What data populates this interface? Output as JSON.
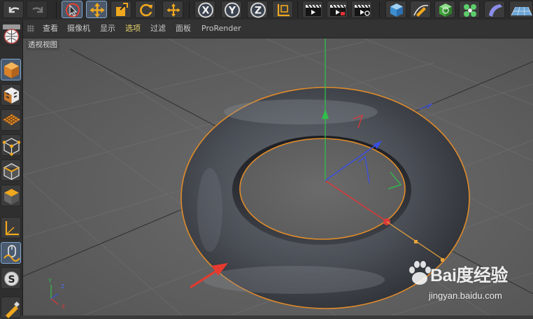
{
  "toolbar": {
    "buttons": [
      {
        "name": "undo-icon"
      },
      {
        "name": "redo-icon"
      },
      {
        "name": "live-selection-icon",
        "active": true
      },
      {
        "name": "move-icon"
      },
      {
        "name": "scale-icon"
      },
      {
        "name": "rotate-icon"
      },
      {
        "name": "recent-tool-icon"
      },
      {
        "name": "x-axis-lock-icon",
        "label": "X"
      },
      {
        "name": "y-axis-lock-icon",
        "label": "Y"
      },
      {
        "name": "z-axis-lock-icon",
        "label": "Z"
      },
      {
        "name": "coordinate-system-icon"
      },
      {
        "name": "render-view-icon"
      },
      {
        "name": "render-to-picture-viewer-icon"
      },
      {
        "name": "render-settings-icon"
      },
      {
        "name": "cube-primitive-icon"
      },
      {
        "name": "pen-spline-icon"
      },
      {
        "name": "subdivision-surface-icon"
      },
      {
        "name": "cloner-icon"
      },
      {
        "name": "bend-deformer-icon"
      },
      {
        "name": "floor-icon"
      }
    ]
  },
  "sidebar": {
    "buttons": [
      {
        "name": "make-editable-icon"
      },
      {
        "name": "model-mode-icon",
        "active": true
      },
      {
        "name": "texture-mode-icon"
      },
      {
        "name": "workplane-mode-icon"
      },
      {
        "name": "points-mode-icon"
      },
      {
        "name": "edges-mode-icon"
      },
      {
        "name": "polygons-mode-icon"
      },
      {
        "name": "axis-mode-icon"
      },
      {
        "name": "tweak-mode-icon"
      },
      {
        "name": "snap-icon"
      },
      {
        "name": "lock-workplane-icon"
      }
    ]
  },
  "menu": {
    "items": [
      {
        "label": "查看"
      },
      {
        "label": "摄像机"
      },
      {
        "label": "显示"
      },
      {
        "label": "选项",
        "active": true
      },
      {
        "label": "过滤"
      },
      {
        "label": "面板"
      },
      {
        "label": "ProRender"
      }
    ]
  },
  "viewport": {
    "label": "透视视图",
    "object": "torus",
    "axis_labels": {
      "x": "X",
      "y": "Y",
      "z": "Z"
    }
  },
  "watermark": {
    "brand": "Bai度经验",
    "site": "jingyan.baidu.com"
  },
  "colors": {
    "selection_outline": "#e08b2b",
    "x_axis": "#d83a3a",
    "y_axis": "#2fbf4a",
    "z_axis": "#3a4fe0",
    "annotation_arrow": "#e53a2e",
    "active_menu": "#e8d36a"
  }
}
